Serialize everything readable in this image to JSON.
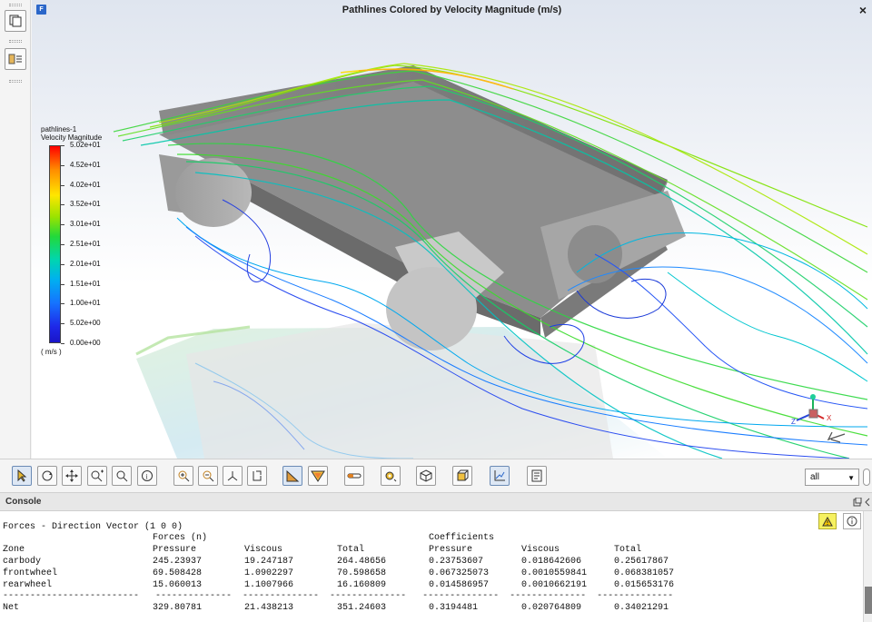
{
  "window": {
    "title": "Pathlines Colored by Velocity Magnitude (m/s)",
    "close_glyph": "×",
    "badge": "F"
  },
  "legend": {
    "title_line1": "pathlines-1",
    "title_line2": "Velocity Magnitude",
    "units": "( m/s )",
    "ticks": [
      "5.02e+01",
      "4.52e+01",
      "4.02e+01",
      "3.52e+01",
      "3.01e+01",
      "2.51e+01",
      "2.01e+01",
      "1.51e+01",
      "1.00e+01",
      "5.02e+00",
      "0.00e+00"
    ],
    "colors": [
      "#ff0000",
      "#ff8c00",
      "#ffe600",
      "#9be300",
      "#22d93a",
      "#00d5b0",
      "#00b0f0",
      "#1573ff",
      "#1e28e8",
      "#1a14c8"
    ]
  },
  "toolbar": {
    "view_select_value": "all",
    "icons": [
      "select-arrow-icon",
      "rotate-icon",
      "pan-icon",
      "zoom-in-out-icon",
      "zoom-window-icon",
      "probe-info-icon",
      "fit-zoom-in-icon",
      "zoom-out-icon",
      "axes-view-icon",
      "orientation-icon",
      "mesh-display-icon",
      "contours-icon",
      "pathlines-icon",
      "settings-gear-icon",
      "box-view-icon",
      "cube-view-icon",
      "xy-plot-icon",
      "report-icon"
    ]
  },
  "console": {
    "title": "Console",
    "heading": "Forces - Direction Vector (1 0 0)",
    "group_headers": {
      "forces": "Forces (n)",
      "coefficients": "Coefficients"
    },
    "columns": [
      "Zone",
      "Pressure",
      "Viscous",
      "Total",
      "Pressure",
      "Viscous",
      "Total"
    ],
    "rows": [
      [
        "carbody",
        "245.23937",
        "19.247187",
        "264.48656",
        "0.23753607",
        "0.018642606",
        "0.25617867"
      ],
      [
        "frontwheel",
        "69.508428",
        "1.0902297",
        "70.598658",
        "0.067325073",
        "0.0010559841",
        "0.068381057"
      ],
      [
        "rearwheel",
        "15.060013",
        "1.1007966",
        "16.160809",
        "0.014586957",
        "0.0010662191",
        "0.015653176"
      ]
    ],
    "separator": "-------------------------   --------------  --------------  --------------   --------------  --------------  --------------",
    "net_row": [
      "Net",
      "329.80781",
      "21.438213",
      "351.24603",
      "0.3194481",
      "0.020764809",
      "0.34021291"
    ]
  },
  "colors": {
    "accent": "#2a66c9",
    "warning": "#f6f160"
  }
}
